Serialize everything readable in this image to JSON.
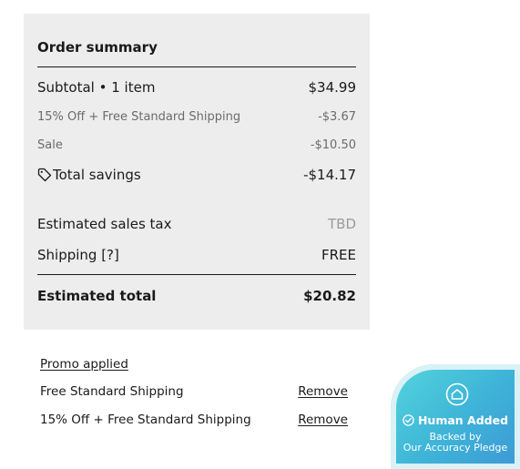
{
  "order_summary": {
    "title": "Order summary",
    "subtotal": {
      "label": "Subtotal • 1 item",
      "value": "$34.99"
    },
    "discount_promo": {
      "label": "15% Off + Free Standard Shipping",
      "value": "-$3.67"
    },
    "discount_sale": {
      "label": "Sale",
      "value": "-$10.50"
    },
    "total_savings": {
      "label": "Total savings",
      "value": "-$14.17",
      "icon": "tag-icon"
    },
    "sales_tax": {
      "label": "Estimated sales tax",
      "value": "TBD"
    },
    "shipping": {
      "label": "Shipping [?]",
      "value": "FREE"
    },
    "estimated_total": {
      "label": "Estimated total",
      "value": "$20.82"
    }
  },
  "promos": {
    "title": "Promo applied",
    "items": [
      {
        "label": "Free Standard Shipping",
        "action": "Remove"
      },
      {
        "label": "15% Off + Free Standard Shipping",
        "action": "Remove"
      }
    ]
  },
  "badge": {
    "headline": "Human Added",
    "line1": "Backed by",
    "line2": "Our Accuracy Pledge",
    "icon": "home-icon",
    "check_icon": "check-circle-icon"
  },
  "colors": {
    "panel_bg": "#ededed",
    "badge_start": "#55d6dd",
    "badge_end": "#3d98d6"
  }
}
